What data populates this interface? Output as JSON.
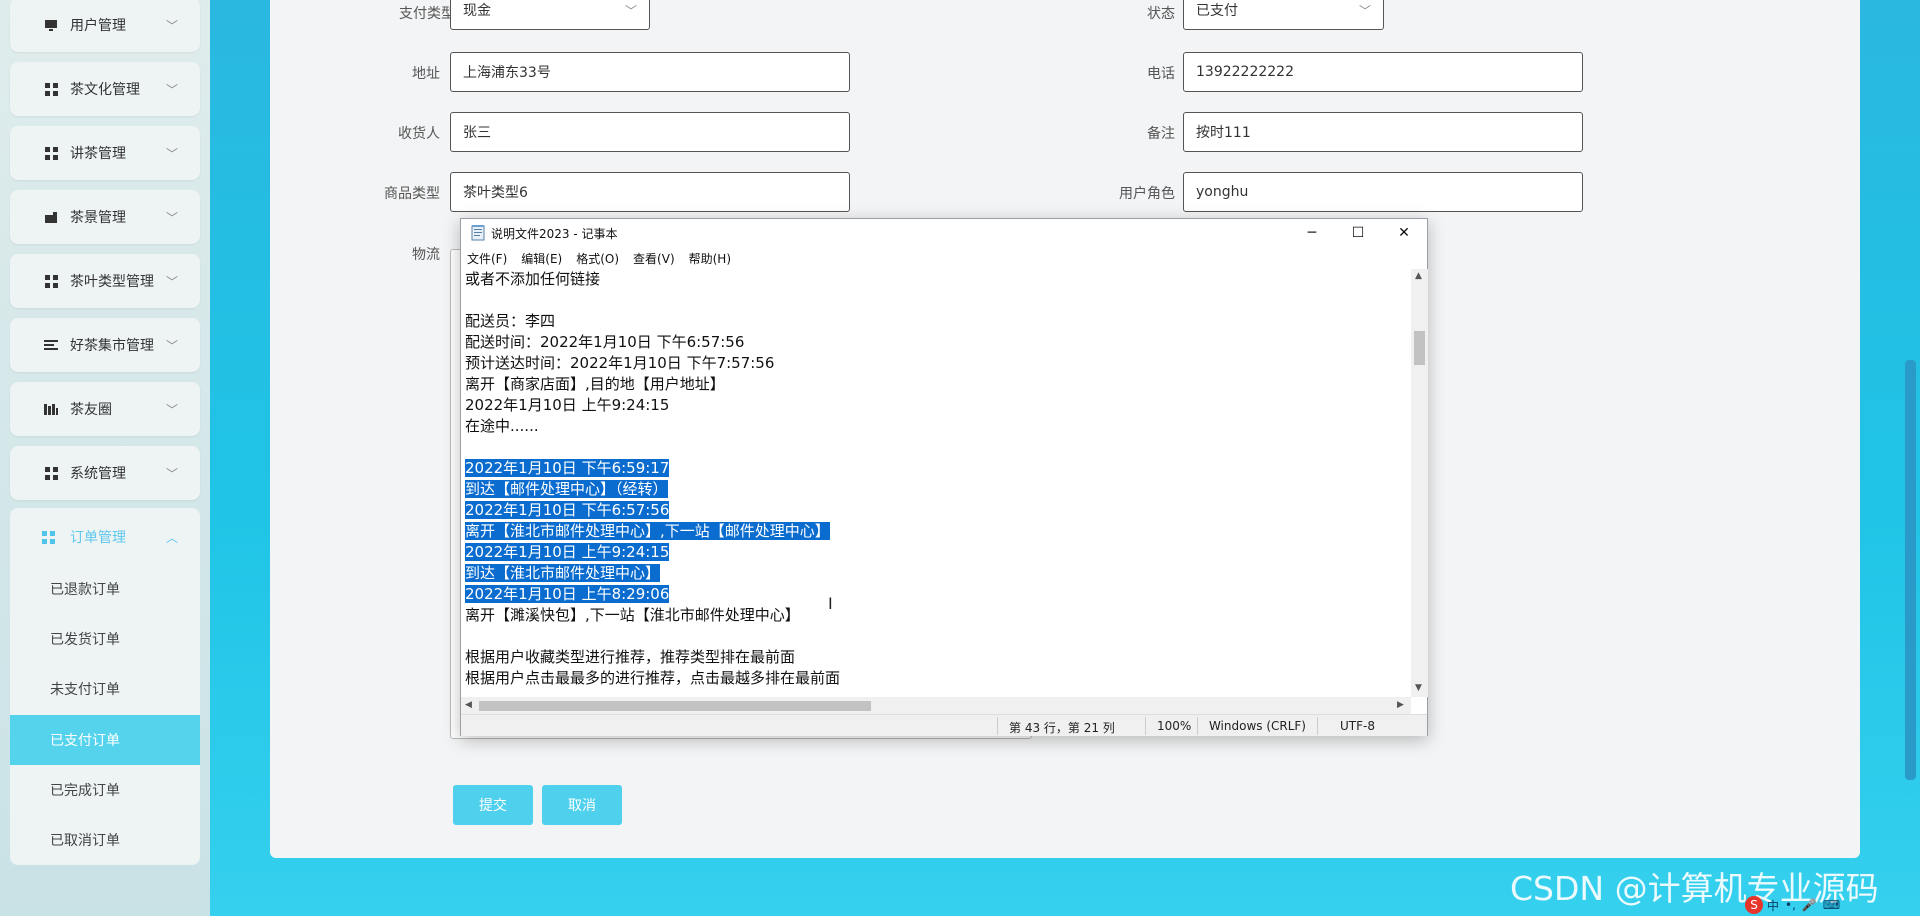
{
  "sidebar": {
    "items": [
      {
        "label": "用户管理",
        "icon": "monitor-icon"
      },
      {
        "label": "茶文化管理",
        "icon": "grid-icon"
      },
      {
        "label": "讲茶管理",
        "icon": "grid-icon"
      },
      {
        "label": "茶景管理",
        "icon": "building-icon"
      },
      {
        "label": "茶叶类型管理",
        "icon": "grid-icon"
      },
      {
        "label": "好茶集市管理",
        "icon": "list-icon"
      },
      {
        "label": "茶友圈",
        "icon": "chart-icon"
      },
      {
        "label": "系统管理",
        "icon": "grid-icon"
      }
    ],
    "order_group": {
      "label": "订单管理",
      "icon": "grid-icon",
      "sub_items": [
        "已退款订单",
        "已发货订单",
        "未支付订单",
        "已支付订单",
        "已完成订单",
        "已取消订单"
      ],
      "active": "已支付订单"
    }
  },
  "form": {
    "pay_type": {
      "label": "支付类型",
      "value": "现金"
    },
    "status": {
      "label": "状态",
      "value": "已支付"
    },
    "address": {
      "label": "地址",
      "value": "上海浦东33号"
    },
    "phone": {
      "label": "电话",
      "value": "13922222222"
    },
    "receiver": {
      "label": "收货人",
      "value": "张三"
    },
    "remark": {
      "label": "备注",
      "value": "按时111"
    },
    "product_type": {
      "label": "商品类型",
      "value": "茶叶类型6"
    },
    "user_role": {
      "label": "用户角色",
      "value": "yonghu"
    },
    "logistics": {
      "label": "物流"
    },
    "submit_label": "提交",
    "cancel_label": "取消"
  },
  "notepad": {
    "title": "说明文件2023 - 记事本",
    "menus": [
      "文件(F)",
      "编辑(E)",
      "格式(O)",
      "查看(V)",
      "帮助(H)"
    ],
    "lines": [
      {
        "text": "或者不添加任何链接",
        "selected": false
      },
      {
        "text": "",
        "selected": false
      },
      {
        "text": "配送员：李四",
        "selected": false
      },
      {
        "text": "配送时间：2022年1月10日 下午6:57:56",
        "selected": false
      },
      {
        "text": "预计送达时间：2022年1月10日 下午7:57:56",
        "selected": false
      },
      {
        "text": "离开【商家店面】,目的地【用户地址】",
        "selected": false
      },
      {
        "text": "2022年1月10日 上午9:24:15",
        "selected": false
      },
      {
        "text": "在途中......",
        "selected": false
      },
      {
        "text": "",
        "selected": false
      },
      {
        "text": "2022年1月10日 下午6:59:17",
        "selected": true
      },
      {
        "text": "到达【邮件处理中心】（经转）",
        "selected": true
      },
      {
        "text": "2022年1月10日 下午6:57:56",
        "selected": true
      },
      {
        "text": "离开【淮北市邮件处理中心】,下一站【邮件处理中心】",
        "selected": true
      },
      {
        "text": "2022年1月10日 上午9:24:15",
        "selected": true
      },
      {
        "text": "到达【淮北市邮件处理中心】",
        "selected": true
      },
      {
        "text": "2022年1月10日 上午8:29:06",
        "selected": true
      },
      {
        "text": "离开【濉溪快包】,下一站【淮北市邮件处理中心】",
        "selected": false
      },
      {
        "text": "",
        "selected": false
      },
      {
        "text": "根据用户收藏类型进行推荐，推荐类型排在最前面",
        "selected": false
      },
      {
        "text": "根据用户点击最最多的进行推荐，点击最越多排在最前面",
        "selected": false
      }
    ],
    "status": {
      "position": "第 43 行，第 21 列",
      "zoom": "100%",
      "line_ending": "Windows (CRLF)",
      "encoding": "UTF-8"
    }
  },
  "watermark": "CSDN @计算机专业源码",
  "tray": {
    "ime": "中"
  },
  "colors": {
    "accent": "#4fd0ec",
    "selection": "#0a6ccf",
    "background": "#2ab8e0"
  }
}
